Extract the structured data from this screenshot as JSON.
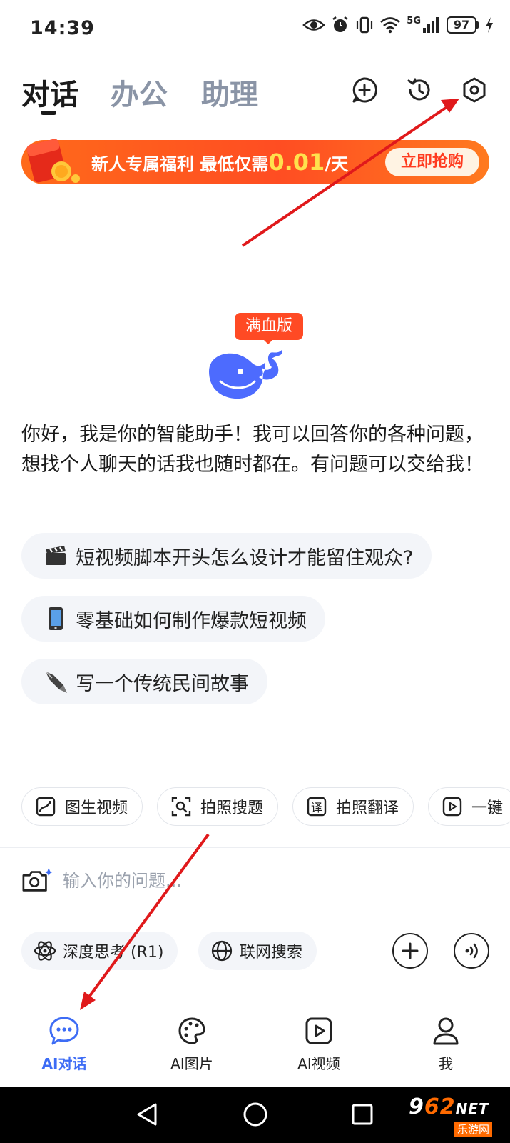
{
  "status_bar": {
    "time": "14:39",
    "network": "5G",
    "battery": "97"
  },
  "header": {
    "tabs": [
      {
        "label": "对话",
        "active": true
      },
      {
        "label": "办公",
        "active": false
      },
      {
        "label": "助理",
        "active": false
      }
    ],
    "actions": [
      "new-chat-icon",
      "history-icon",
      "settings-icon"
    ]
  },
  "promo": {
    "text_prefix": "新人专属福利 最低仅需",
    "price": "0.01",
    "text_suffix": "/天",
    "button_label": "立即抢购",
    "colors": {
      "start": "#ff6a1a",
      "end": "#ff7a1f",
      "price": "#ffe14d"
    }
  },
  "logo": {
    "badge": "满血版",
    "brand_color": "#4d6bfe",
    "badge_color": "#ff4a24"
  },
  "greeting": "你好，我是你的智能助手！我可以回答你的各种问题，想找个人聊天的话我也随时都在。有问题可以交给我！",
  "suggestions": [
    {
      "emoji": "🎬",
      "text": "短视频脚本开头怎么设计才能留住观众?"
    },
    {
      "emoji": "📱",
      "text": "零基础如何制作爆款短视频"
    },
    {
      "emoji": "✒️",
      "text": "写一个传统民间故事"
    }
  ],
  "tools": [
    {
      "icon": "image-video-icon",
      "label": "图生视频"
    },
    {
      "icon": "photo-search-icon",
      "label": "拍照搜题"
    },
    {
      "icon": "translate-icon",
      "label": "拍照翻译"
    },
    {
      "icon": "play-icon",
      "label": "一键"
    }
  ],
  "input": {
    "placeholder": "输入你的问题..."
  },
  "options": [
    {
      "icon": "atom-icon",
      "label": "深度思考 (R1)"
    },
    {
      "icon": "globe-icon",
      "label": "联网搜索"
    }
  ],
  "bottom_nav": [
    {
      "icon": "chat-bubble-icon",
      "label": "AI对话",
      "active": true
    },
    {
      "icon": "palette-icon",
      "label": "AI图片",
      "active": false
    },
    {
      "icon": "video-icon",
      "label": "AI视频",
      "active": false
    },
    {
      "icon": "user-icon",
      "label": "我",
      "active": false
    }
  ],
  "accent_color": "#3d6cf5",
  "annotation_color": "#e0191b",
  "watermark": {
    "main_prefix": "9",
    "main_accent": "62",
    "main_suffix": "NET",
    "sub": "乐游网"
  }
}
